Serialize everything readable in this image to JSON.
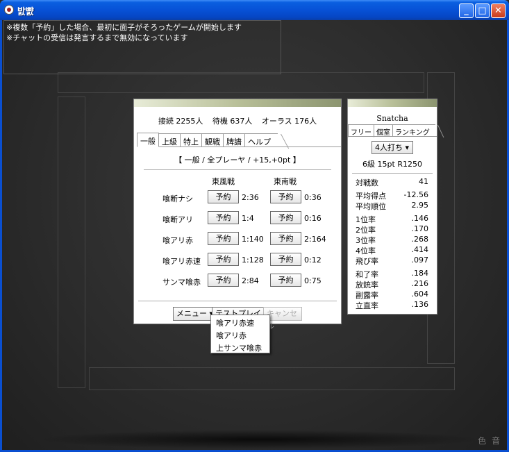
{
  "window": {
    "title": "밠뺤",
    "min": "_",
    "max": "□",
    "close": "✕"
  },
  "chat": {
    "lines": [
      "※複数「予約」した場合、最初に面子がそろったゲームが開始します",
      "※チャットの受信は発言するまで無効になっています"
    ]
  },
  "lobby": {
    "stats": {
      "connected": "接続 2255人",
      "waiting": "待機 637人",
      "allLast": "オーラス 176人"
    },
    "tabs": [
      "一般",
      "上級",
      "特上",
      "観戦",
      "牌譜",
      "ヘルプ"
    ],
    "subtitle": "【 一般 / 全プレーヤ / +15,+0pt 】",
    "columns": {
      "east": "東風戦",
      "south": "東南戦"
    },
    "reserve": "予約",
    "rows": [
      {
        "label": "喰断ナシ",
        "east": "2:36",
        "south": "0:36"
      },
      {
        "label": "喰断アリ",
        "east": "1:4",
        "south": "0:16"
      },
      {
        "label": "喰アリ赤",
        "east": "1:140",
        "south": "2:164"
      },
      {
        "label": "喰アリ赤速",
        "east": "1:128",
        "south": "0:12"
      },
      {
        "label": "サンマ喰赤",
        "east": "2:84",
        "south": "0:75"
      }
    ],
    "footer": {
      "menu": "メニュー ▾",
      "testplay": "テストプレイ ▾",
      "cancel": "キャンセル"
    },
    "popup": [
      "喰アリ赤速",
      "喰アリ赤",
      "上サンマ喰赤"
    ]
  },
  "profile": {
    "name": "Snatcha",
    "tabs": [
      "フリー",
      "個室",
      "ランキング"
    ],
    "mode": "4人打ち ▾",
    "rank": "6級 15pt R1250",
    "stats": [
      {
        "k": "対戦数",
        "v": "41"
      },
      {
        "k": "平均得点",
        "v": "-12.56"
      },
      {
        "k": "平均順位",
        "v": "2.95"
      },
      {
        "k": "1位率",
        "v": ".146"
      },
      {
        "k": "2位率",
        "v": ".170"
      },
      {
        "k": "3位率",
        "v": ".268"
      },
      {
        "k": "4位率",
        "v": ".414"
      },
      {
        "k": "飛び率",
        "v": ".097"
      },
      {
        "k": "和了率",
        "v": ".184"
      },
      {
        "k": "放銃率",
        "v": ".216"
      },
      {
        "k": "副露率",
        "v": ".604"
      },
      {
        "k": "立直率",
        "v": ".136"
      }
    ]
  },
  "corner": "色 音"
}
